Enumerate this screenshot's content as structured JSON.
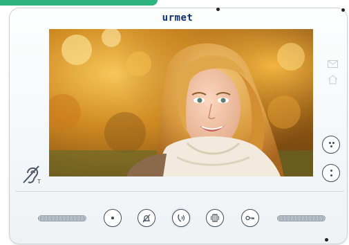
{
  "brand": {
    "logo_text": "urmet"
  },
  "colors": {
    "accent": "#2fb37f",
    "brand": "#0b2e6f",
    "button_outline": "#3c4a58",
    "inactive_icon": "#c5ccd3"
  },
  "screen": {
    "content": "video-feed-visitor"
  },
  "status_icons": [
    {
      "name": "envelope-icon",
      "active": false
    },
    {
      "name": "home-icon",
      "active": false
    }
  ],
  "side_buttons": [
    {
      "name": "side-button-upper",
      "icon": "dots-icon"
    },
    {
      "name": "side-button-lower",
      "icon": "dots-icon"
    }
  ],
  "hearing_aid": {
    "icon": "hearing-aid-icon",
    "label": "T"
  },
  "control_buttons": [
    {
      "name": "menu-button",
      "icon": "dot-icon"
    },
    {
      "name": "mute-button",
      "icon": "bell-mute-icon"
    },
    {
      "name": "talk-button",
      "icon": "handset-audio-icon"
    },
    {
      "name": "door-panel-button",
      "icon": "door-icon"
    },
    {
      "name": "door-release-button",
      "icon": "key-icon"
    }
  ]
}
